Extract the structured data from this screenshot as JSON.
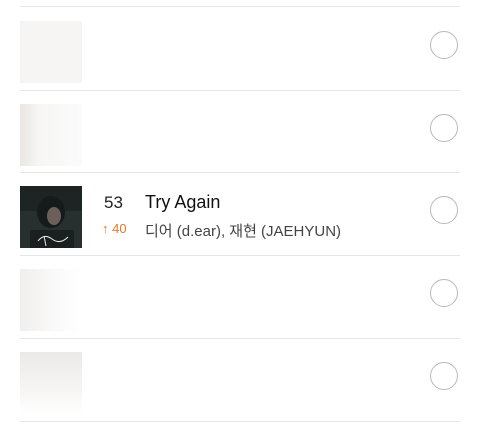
{
  "chart_list": {
    "rows": [
      {
        "state": "faded"
      },
      {
        "state": "faded"
      },
      {
        "state": "visible",
        "rank": "53",
        "change": "40",
        "change_icon": "arrow-up-icon",
        "title": "Try Again",
        "artist": "디어 (d.ear), 재현 (JAEHYUN)"
      },
      {
        "state": "faded"
      },
      {
        "state": "faded"
      }
    ]
  },
  "colors": {
    "rank_up": "#e07a2a",
    "divider": "#e6e6e6",
    "select_ring": "#b9b9b9"
  }
}
